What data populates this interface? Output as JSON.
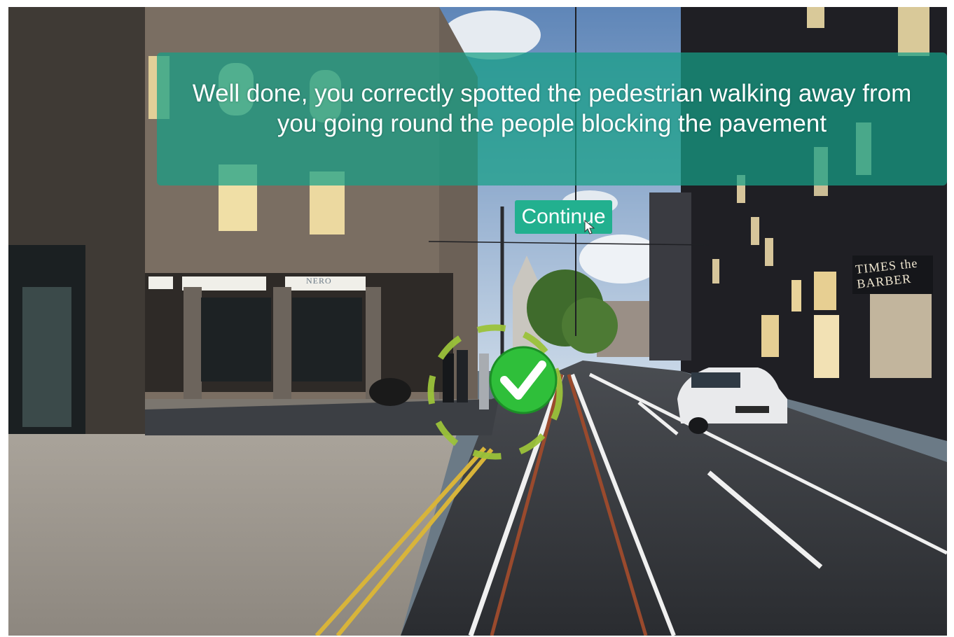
{
  "feedback": {
    "message": "Well done, you correctly spotted the pedestrian walking away from you going round the people blocking the pavement"
  },
  "continue_button": {
    "label": "Continue"
  },
  "scenery": {
    "barber_sign": "TIMES the BARBER",
    "cafe_sign": "NERO"
  },
  "icons": {
    "target_marker": "check-circle-icon",
    "cursor": "mouse-pointer-icon"
  },
  "colors": {
    "banner": "#16a087",
    "button": "#22b08f",
    "check": "#2fbf3a",
    "dash_ring": "#9bc23a"
  }
}
